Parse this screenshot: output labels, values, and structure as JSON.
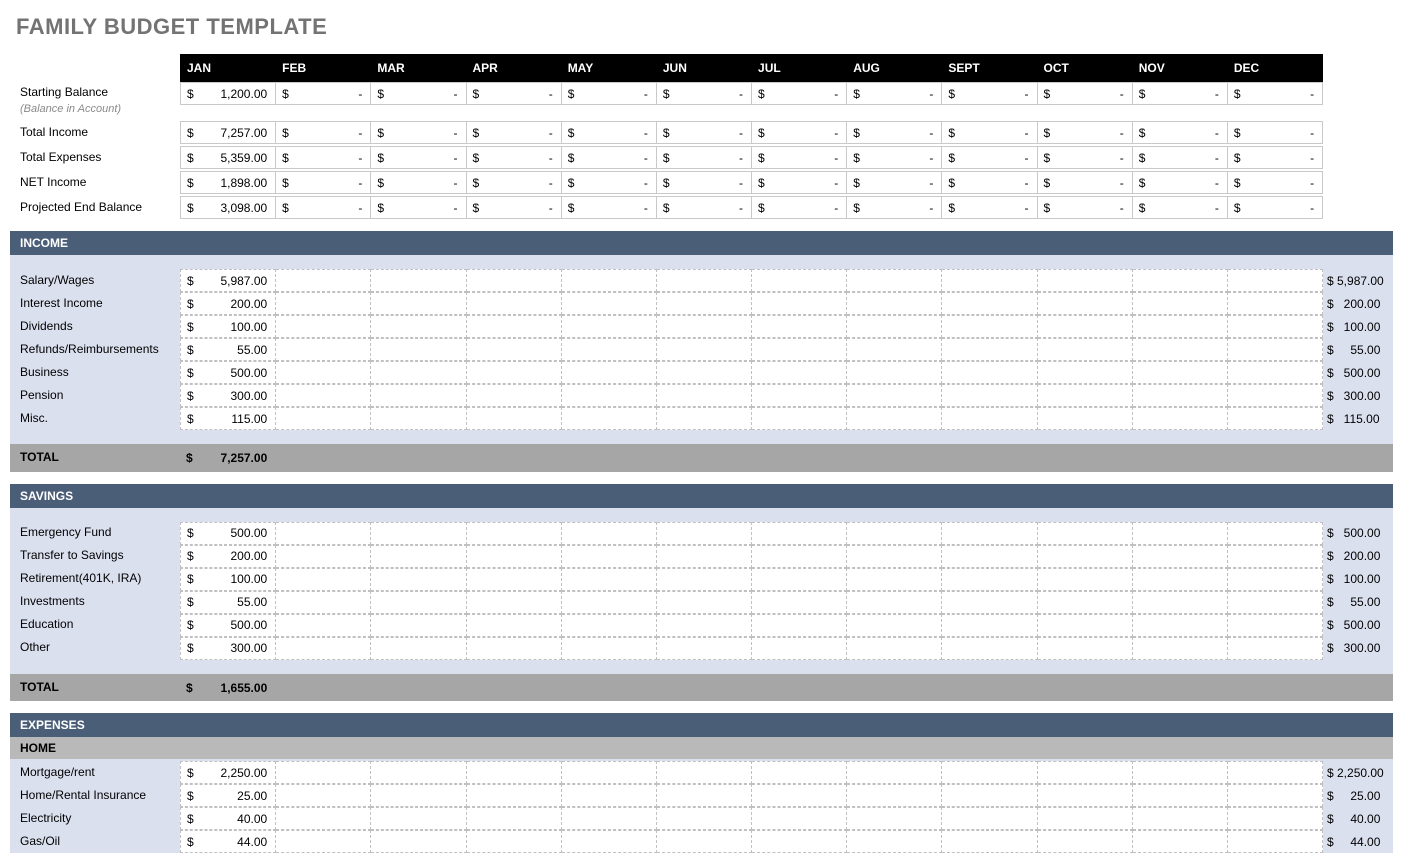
{
  "title": "FAMILY BUDGET TEMPLATE",
  "months": [
    "JAN",
    "FEB",
    "MAR",
    "APR",
    "MAY",
    "JUN",
    "JUL",
    "AUG",
    "SEPT",
    "OCT",
    "NOV",
    "DEC"
  ],
  "currency_symbol": "$",
  "dash": "-",
  "summary": {
    "starting_balance": {
      "label": "Starting Balance",
      "sublabel": "(Balance in Account)",
      "jan": "1,200.00"
    },
    "total_income": {
      "label": "Total Income",
      "jan": "7,257.00"
    },
    "total_expenses": {
      "label": "Total Expenses",
      "jan": "5,359.00"
    },
    "net_income": {
      "label": "NET Income",
      "jan": "1,898.00"
    },
    "projected_end": {
      "label": "Projected End Balance",
      "jan": "3,098.00"
    }
  },
  "income": {
    "header": "INCOME",
    "rows": [
      {
        "label": "Salary/Wages",
        "jan": "5,987.00",
        "total": "$ 5,987.00"
      },
      {
        "label": "Interest Income",
        "jan": "200.00",
        "total": "$   200.00"
      },
      {
        "label": "Dividends",
        "jan": "100.00",
        "total": "$   100.00"
      },
      {
        "label": "Refunds/Reimbursements",
        "jan": "55.00",
        "total": "$     55.00"
      },
      {
        "label": "Business",
        "jan": "500.00",
        "total": "$   500.00"
      },
      {
        "label": "Pension",
        "jan": "300.00",
        "total": "$   300.00"
      },
      {
        "label": "Misc.",
        "jan": "115.00",
        "total": "$   115.00"
      }
    ],
    "total_label": "TOTAL",
    "total_jan": "7,257.00"
  },
  "savings": {
    "header": "SAVINGS",
    "rows": [
      {
        "label": "Emergency Fund",
        "jan": "500.00",
        "total": "$   500.00"
      },
      {
        "label": "Transfer to Savings",
        "jan": "200.00",
        "total": "$   200.00"
      },
      {
        "label": "Retirement(401K, IRA)",
        "jan": "100.00",
        "total": "$   100.00"
      },
      {
        "label": "Investments",
        "jan": "55.00",
        "total": "$     55.00"
      },
      {
        "label": "Education",
        "jan": "500.00",
        "total": "$   500.00"
      },
      {
        "label": "Other",
        "jan": "300.00",
        "total": "$   300.00"
      }
    ],
    "total_label": "TOTAL",
    "total_jan": "1,655.00"
  },
  "expenses": {
    "header": "EXPENSES",
    "home": {
      "header": "HOME",
      "rows": [
        {
          "label": "Mortgage/rent",
          "jan": "2,250.00",
          "total": "$ 2,250.00"
        },
        {
          "label": "Home/Rental Insurance",
          "jan": "25.00",
          "total": "$     25.00"
        },
        {
          "label": "Electricity",
          "jan": "40.00",
          "total": "$     40.00"
        },
        {
          "label": "Gas/Oil",
          "jan": "44.00",
          "total": "$     44.00"
        }
      ]
    }
  }
}
